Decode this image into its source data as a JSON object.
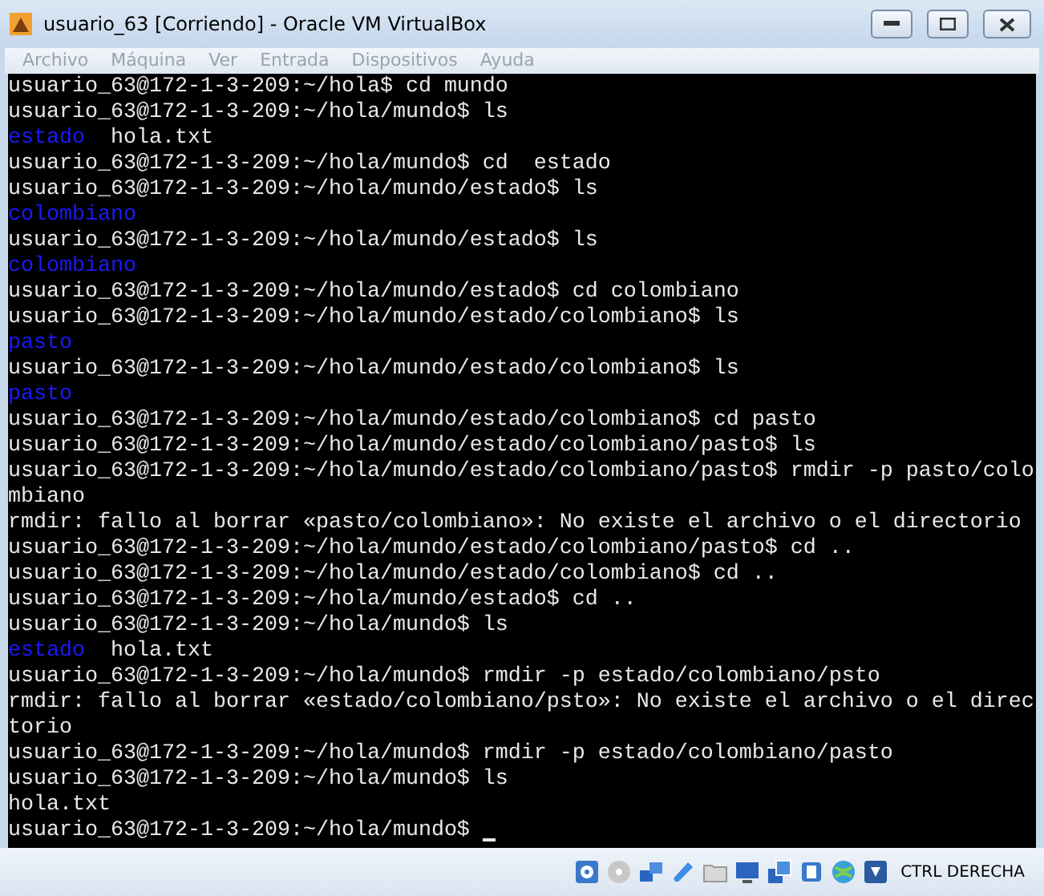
{
  "window": {
    "title": "usuario_63 [Corriendo] - Oracle VM VirtualBox"
  },
  "menu": [
    {
      "label": "Archivo",
      "disabled": true
    },
    {
      "label": "Máquina",
      "disabled": true
    },
    {
      "label": "Ver",
      "disabled": true
    },
    {
      "label": "Entrada",
      "disabled": true
    },
    {
      "label": "Dispositivos",
      "disabled": true
    },
    {
      "label": "Ayuda",
      "disabled": true
    }
  ],
  "terminal": {
    "lines": [
      [
        {
          "text": "usuario_63@172-1-3-209:~/hola$ cd mundo",
          "kind": "text"
        }
      ],
      [
        {
          "text": "usuario_63@172-1-3-209:~/hola/mundo$ ls",
          "kind": "text"
        }
      ],
      [
        {
          "text": "estado",
          "kind": "dir"
        },
        {
          "text": "  hola.txt",
          "kind": "text"
        }
      ],
      [
        {
          "text": "usuario_63@172-1-3-209:~/hola/mundo$ cd  estado",
          "kind": "text"
        }
      ],
      [
        {
          "text": "usuario_63@172-1-3-209:~/hola/mundo/estado$ ls",
          "kind": "text"
        }
      ],
      [
        {
          "text": "colombiano",
          "kind": "dir"
        }
      ],
      [
        {
          "text": "usuario_63@172-1-3-209:~/hola/mundo/estado$ ls",
          "kind": "text"
        }
      ],
      [
        {
          "text": "colombiano",
          "kind": "dir"
        }
      ],
      [
        {
          "text": "usuario_63@172-1-3-209:~/hola/mundo/estado$ cd colombiano",
          "kind": "text"
        }
      ],
      [
        {
          "text": "usuario_63@172-1-3-209:~/hola/mundo/estado/colombiano$ ls",
          "kind": "text"
        }
      ],
      [
        {
          "text": "pasto",
          "kind": "dir"
        }
      ],
      [
        {
          "text": "usuario_63@172-1-3-209:~/hola/mundo/estado/colombiano$ ls",
          "kind": "text"
        }
      ],
      [
        {
          "text": "pasto",
          "kind": "dir"
        }
      ],
      [
        {
          "text": "usuario_63@172-1-3-209:~/hola/mundo/estado/colombiano$ cd pasto",
          "kind": "text"
        }
      ],
      [
        {
          "text": "usuario_63@172-1-3-209:~/hola/mundo/estado/colombiano/pasto$ ls",
          "kind": "text"
        }
      ],
      [
        {
          "text": "usuario_63@172-1-3-209:~/hola/mundo/estado/colombiano/pasto$ rmdir -p pasto/colo",
          "kind": "text"
        }
      ],
      [
        {
          "text": "mbiano",
          "kind": "text"
        }
      ],
      [
        {
          "text": "rmdir: fallo al borrar «pasto/colombiano»: No existe el archivo o el directorio",
          "kind": "text"
        }
      ],
      [
        {
          "text": "usuario_63@172-1-3-209:~/hola/mundo/estado/colombiano/pasto$ cd ..",
          "kind": "text"
        }
      ],
      [
        {
          "text": "usuario_63@172-1-3-209:~/hola/mundo/estado/colombiano$ cd ..",
          "kind": "text"
        }
      ],
      [
        {
          "text": "usuario_63@172-1-3-209:~/hola/mundo/estado$ cd ..",
          "kind": "text"
        }
      ],
      [
        {
          "text": "usuario_63@172-1-3-209:~/hola/mundo$ ls",
          "kind": "text"
        }
      ],
      [
        {
          "text": "estado",
          "kind": "dir"
        },
        {
          "text": "  hola.txt",
          "kind": "text"
        }
      ],
      [
        {
          "text": "usuario_63@172-1-3-209:~/hola/mundo$ rmdir -p estado/colombiano/psto",
          "kind": "text"
        }
      ],
      [
        {
          "text": "rmdir: fallo al borrar «estado/colombiano/psto»: No existe el archivo o el direc",
          "kind": "text"
        }
      ],
      [
        {
          "text": "torio",
          "kind": "text"
        }
      ],
      [
        {
          "text": "usuario_63@172-1-3-209:~/hola/mundo$ rmdir -p estado/colombiano/pasto",
          "kind": "text"
        }
      ],
      [
        {
          "text": "usuario_63@172-1-3-209:~/hola/mundo$ ls",
          "kind": "text"
        }
      ],
      [
        {
          "text": "hola.txt",
          "kind": "text"
        }
      ],
      [
        {
          "text": "usuario_63@172-1-3-209:~/hola/mundo$ ",
          "kind": "text"
        },
        {
          "kind": "cursor"
        }
      ]
    ]
  },
  "status_bar": {
    "host_key": "CTRL DERECHA"
  }
}
